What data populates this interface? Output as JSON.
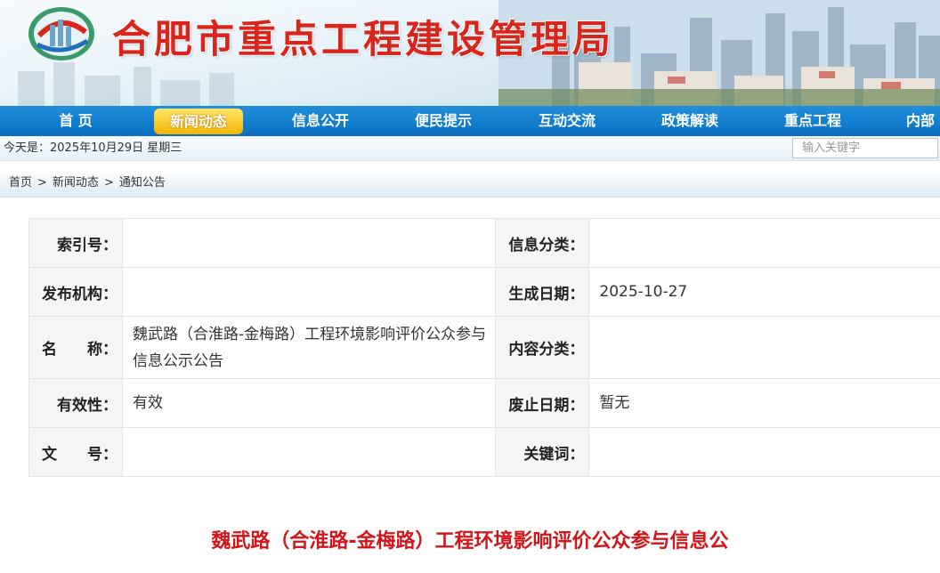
{
  "header": {
    "title": "合肥市重点工程建设管理局"
  },
  "nav": {
    "items": [
      {
        "label": "首 页",
        "active": false
      },
      {
        "label": "新闻动态",
        "active": true
      },
      {
        "label": "信息公开",
        "active": false
      },
      {
        "label": "便民提示",
        "active": false
      },
      {
        "label": "互动交流",
        "active": false
      },
      {
        "label": "政策解读",
        "active": false
      },
      {
        "label": "重点工程",
        "active": false
      },
      {
        "label": "内部",
        "active": false
      }
    ]
  },
  "datebar": {
    "date_text": "今天是：2025年10月29日 星期三",
    "search_placeholder": "输入关键字"
  },
  "breadcrumb": {
    "items": [
      "首页",
      "新闻动态",
      "通知公告"
    ],
    "separator": ">"
  },
  "info_table": {
    "index_label": "索引号：",
    "index_value": "",
    "category_label": "信息分类：",
    "category_value": "",
    "publisher_label": "发布机构：",
    "publisher_value": "",
    "created_label": "生成日期：",
    "created_value": "2025-10-27",
    "name_label_1": "名",
    "name_label_2": "称：",
    "name_value": "魏武路（合淮路-金梅路）工程环境影响评价公众参与信息公示公告",
    "content_cat_label": "内容分类：",
    "content_cat_value": "",
    "validity_label": "有效性：",
    "validity_value": "有效",
    "abolish_label": "废止日期：",
    "abolish_value": "暂无",
    "docno_label_1": "文",
    "docno_label_2": "号：",
    "docno_value": "",
    "keywords_label": "关键词：",
    "keywords_value": ""
  },
  "article": {
    "title": "魏武路（合淮路-金梅路）工程环境影响评价公众参与信息公"
  },
  "colors": {
    "title_red": "#d8261c",
    "nav_blue": "#0a6fc2",
    "active_yellow": "#f4b400"
  }
}
